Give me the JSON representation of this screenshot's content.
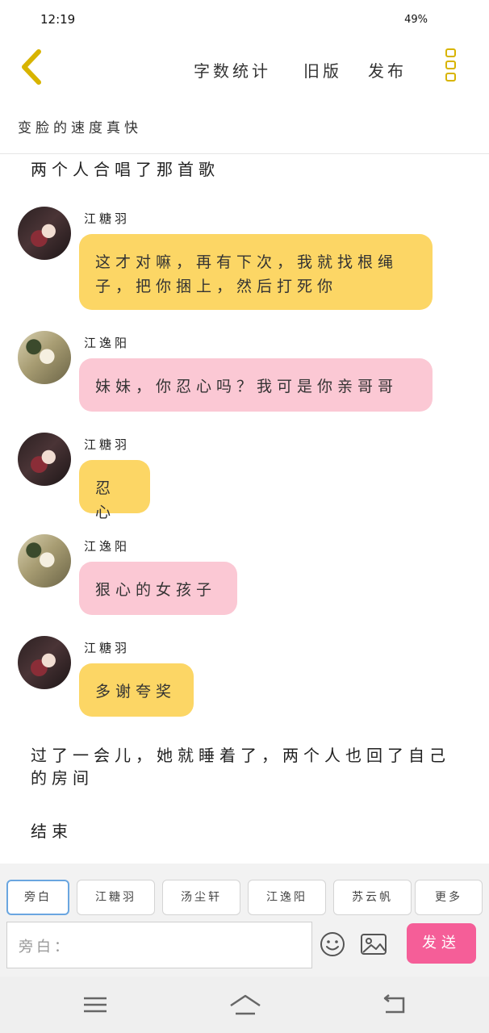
{
  "status": {
    "time": "12:19",
    "battery": "49%"
  },
  "top_bar": {
    "links": [
      "字数统计",
      "旧版",
      "发布"
    ]
  },
  "story_title": "变脸的速度真快",
  "narration": {
    "first": "两个人合唱了那首歌",
    "second": "过了一会儿，她就睡着了，两个人也回了自己的房间",
    "end": "结束"
  },
  "messages": [
    {
      "sender": "江糖羽",
      "text": "这才对嘛，再有下次，我就找根绳子，把你捆上，然后打死你",
      "color": "yellow"
    },
    {
      "sender": "江逸阳",
      "text": "妹妹，你忍心吗？我可是你亲哥哥",
      "color": "pink"
    },
    {
      "sender": "江糖羽",
      "text": "忍心",
      "color": "yellow"
    },
    {
      "sender": "江逸阳",
      "text": "狠心的女孩子",
      "color": "pink"
    },
    {
      "sender": "江糖羽",
      "text": "多谢夸奖",
      "color": "yellow"
    }
  ],
  "characters": [
    "旁白",
    "江糖羽",
    "汤尘轩",
    "江逸阳",
    "苏云帆",
    "更多"
  ],
  "input": {
    "placeholder": "旁白："
  },
  "send_label": "发送",
  "colors": {
    "yellow_bubble": "#fcd665",
    "pink_bubble": "#fbc8d4",
    "send": "#f55e98",
    "accent": "#d8b400"
  },
  "icons": [
    "back-chevron-icon",
    "menu-dots-icon",
    "emoji-icon",
    "image-icon",
    "nav-menu-icon",
    "nav-home-icon",
    "nav-back-icon"
  ]
}
